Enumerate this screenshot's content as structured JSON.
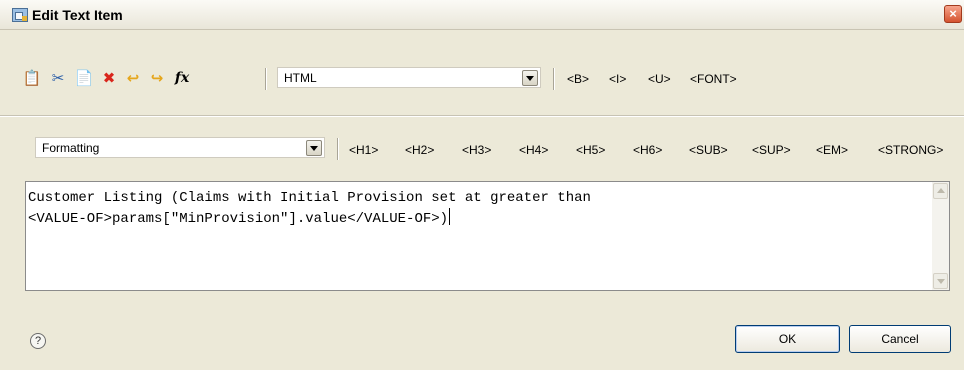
{
  "window": {
    "title": "Edit Text Item",
    "close_glyph": "×"
  },
  "toolbar": {
    "icons": [
      {
        "name": "copy-icon",
        "glyph": "📋",
        "color": "#5a6f8f"
      },
      {
        "name": "cut-icon",
        "glyph": "✂",
        "color": "#2b5ea8"
      },
      {
        "name": "paste-icon",
        "glyph": "📄",
        "color": "#8a8a8a"
      },
      {
        "name": "delete-icon",
        "glyph": "✖",
        "color": "#d9261c"
      },
      {
        "name": "undo-icon",
        "glyph": "↩",
        "color": "#e5a61c"
      },
      {
        "name": "redo-icon",
        "glyph": "↪",
        "color": "#e5a61c"
      },
      {
        "name": "function-icon",
        "glyph": "fx",
        "color": "#000000"
      }
    ],
    "format_combo": {
      "value": "HTML"
    },
    "tags": [
      "<B>",
      "<I>",
      "<U>",
      "<FONT>"
    ]
  },
  "formatting": {
    "combo": {
      "value": "Formatting"
    },
    "tags": [
      "<H1>",
      "<H2>",
      "<H3>",
      "<H4>",
      "<H5>",
      "<H6>",
      "<SUB>",
      "<SUP>",
      "<EM>",
      "<STRONG>"
    ]
  },
  "editor": {
    "lines": [
      "Customer Listing (Claims with Initial Provision set at greater than",
      "<VALUE-OF>params[\"MinProvision\"].value</VALUE-OF>)"
    ]
  },
  "footer": {
    "help_glyph": "?",
    "ok_label": "OK",
    "cancel_label": "Cancel"
  }
}
